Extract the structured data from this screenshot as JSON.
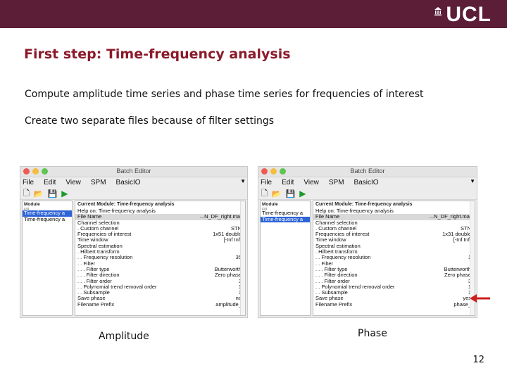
{
  "header": {
    "logo_text": "UCL"
  },
  "slide": {
    "title": "First step: Time-frequency analysis",
    "bullets": [
      "Compute amplitude time series and phase time series for frequencies of interest",
      "Create two separate files because of filter settings"
    ],
    "captions": [
      "Amplitude",
      "Phase"
    ],
    "page_number": "12"
  },
  "windows": [
    {
      "title": "Batch Editor",
      "menu": [
        "File",
        "Edit",
        "View",
        "SPM",
        "BasicIO"
      ],
      "module_header": "Module",
      "module_subheader": "List",
      "modules": [
        "Time-frequency a",
        "Time-frequency a"
      ],
      "current_header": "Current Module: Time-frequency analysis",
      "rows": [
        {
          "label": "Help on: Time-frequency analysis",
          "value": ""
        },
        {
          "label": "File Name",
          "value": "...N_DF_right.mat"
        },
        {
          "label": "Channel selection",
          "value": ""
        },
        {
          "label": ". Custom channel",
          "value": "STN"
        },
        {
          "label": "Frequencies of interest",
          "value": "1x51 double"
        },
        {
          "label": "Time window",
          "value": "[-Inf Inf]"
        },
        {
          "label": "Spectral estimation",
          "value": ""
        },
        {
          "label": ". Hilbert transform",
          "value": ""
        },
        {
          "label": ". . Frequency resolution",
          "value": "35"
        },
        {
          "label": ". . Filter",
          "value": ""
        },
        {
          "label": ". . . Filter type",
          "value": "Butterworth"
        },
        {
          "label": ". . . Filter direction",
          "value": "Zero phase"
        },
        {
          "label": ". . . Filter order",
          "value": "3"
        },
        {
          "label": ". . Polynomial trend removal order",
          "value": "1"
        },
        {
          "label": ". . Subsample",
          "value": "1"
        },
        {
          "label": "Save phase",
          "value": "no"
        },
        {
          "label": "Filename Prefix",
          "value": "amplitude_"
        }
      ]
    },
    {
      "title": "Batch Editor",
      "menu": [
        "File",
        "Edit",
        "View",
        "SPM",
        "BasicIO"
      ],
      "module_header": "Module",
      "module_subheader": "List",
      "modules": [
        "Time-frequency a",
        "Time-frequency a"
      ],
      "current_header": "Current Module: Time-frequency analysis",
      "rows": [
        {
          "label": "Help on: Time-frequency analysis",
          "value": ""
        },
        {
          "label": "File Name",
          "value": "...N_DF_right.mat"
        },
        {
          "label": "Channel selection",
          "value": ""
        },
        {
          "label": ". Custom channel",
          "value": "STN"
        },
        {
          "label": "Frequencies of interest",
          "value": "1x31 double"
        },
        {
          "label": "Time window",
          "value": "[-Inf Inf]"
        },
        {
          "label": "Spectral estimation",
          "value": ""
        },
        {
          "label": ". Hilbert transform",
          "value": ""
        },
        {
          "label": ". . Frequency resolution",
          "value": "1"
        },
        {
          "label": ". . Filter",
          "value": ""
        },
        {
          "label": ". . . Filter type",
          "value": "Butterworth"
        },
        {
          "label": ". . . Filter direction",
          "value": "Zero phase"
        },
        {
          "label": ". . . Filter order",
          "value": "3"
        },
        {
          "label": ". . Polynomial trend removal order",
          "value": "1"
        },
        {
          "label": ". . Subsample",
          "value": "1"
        },
        {
          "label": "Save phase",
          "value": "yes"
        },
        {
          "label": "Filename Prefix",
          "value": "phase_"
        }
      ]
    }
  ],
  "colors": {
    "banner": "#5b1e36",
    "title": "#8b1a2a",
    "arrow": "#cc1f1f",
    "selection": "#2d64d6"
  }
}
